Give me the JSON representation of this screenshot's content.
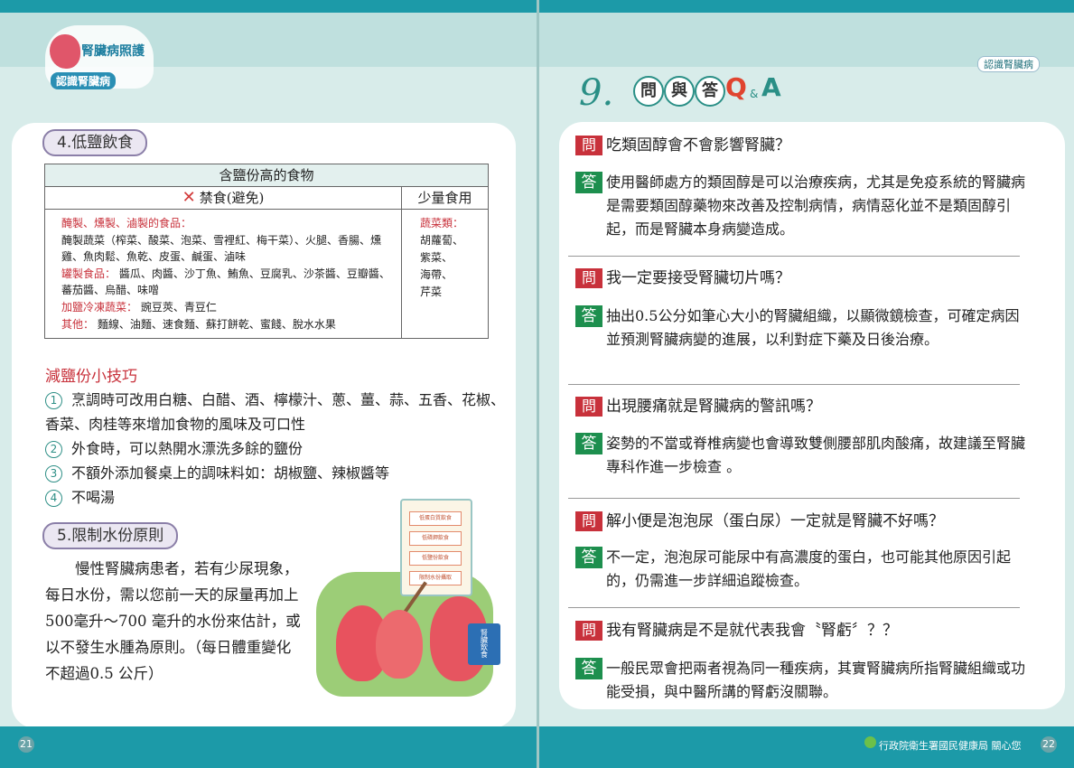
{
  "left_page": {
    "logo": {
      "title": "腎臟病照護",
      "subtitle": "認識腎臟病"
    },
    "section4": {
      "title": "4.低鹽飲食",
      "table": {
        "header": "含鹽份高的食物",
        "col_forbidden": "禁食(避免)",
        "col_small": "少量食用",
        "forbidden_items": [
          {
            "category": "醃製、燻製、滷製的食品：",
            "text": ""
          },
          {
            "category": "",
            "text": "醃製蔬菜（榨菜、酸菜、泡菜、雪裡紅、梅干菜）、火腿、香腸、燻雞、魚肉鬆、魚乾、皮蛋、鹹蛋、滷味"
          },
          {
            "category": "罐製食品：",
            "text": "醬瓜、肉醬、沙丁魚、鮪魚、豆腐乳、沙茶醬、豆瓣醬、蕃茄醬、烏醋、味噌"
          },
          {
            "category": "加鹽冷凍蔬菜：",
            "text": "豌豆莢、青豆仁"
          },
          {
            "category": "其他：",
            "text": "麵線、油麵、速食麵、蘇打餅乾、蜜餞、脫水水果"
          }
        ],
        "small_category": "蔬菜類：",
        "small_items": [
          "胡蘿蔔、",
          "紫菜、",
          "海帶、",
          "芹菜"
        ]
      },
      "tips_title": "減鹽份小技巧",
      "tips": [
        {
          "num": "1",
          "text": "烹調時可改用白糖、白醋、酒、檸檬汁、蔥、薑、蒜、五香、花椒、香菜、肉桂等來增加食物的風味及可口性"
        },
        {
          "num": "2",
          "text": "外食時，可以熱開水漂洗多餘的鹽份"
        },
        {
          "num": "3",
          "text": "不額外添加餐桌上的調味料如：胡椒鹽、辣椒醬等"
        },
        {
          "num": "4",
          "text": "不喝湯"
        }
      ]
    },
    "section5": {
      "title": "5.限制水份原則",
      "text": "慢性腎臟病患者，若有少尿現象，每日水份，需以您前一天的尿量再加上500毫升～700 毫升的水份來估計，或以不發生水腫為原則。（每日體重變化不超過0.5 公斤）"
    },
    "illustration": {
      "scroll_items": [
        "低蛋白質飲食",
        "低磷鉀飲食",
        "低鹽份飲食",
        "限制水份攝取"
      ],
      "book_label": "腎臟飲食"
    },
    "page_number": "21"
  },
  "right_page": {
    "top_tag": "認識腎臟病",
    "heading": {
      "number": "9.",
      "chars": [
        "問",
        "與",
        "答"
      ],
      "q": "Q",
      "amp": "&",
      "a": "A"
    },
    "q_label": "問",
    "a_label": "答",
    "qa": [
      {
        "q": "吃類固醇會不會影響腎臟？",
        "a": "使用醫師處方的類固醇是可以治療疾病，尤其是免疫系統的腎臟病是需要類固醇藥物來改善及控制病情，病情惡化並不是類固醇引起，而是腎臟本身病變造成。"
      },
      {
        "q": "我一定要接受腎臟切片嗎？",
        "a": "抽出0.5公分如筆心大小的腎臟組織，以顯微鏡檢查，可確定病因並預測腎臟病變的進展，以利對症下藥及日後治療。"
      },
      {
        "q": "出現腰痛就是腎臟病的警訊嗎？",
        "a": "姿勢的不當或脊椎病變也會導致雙側腰部肌肉酸痛，故建議至腎臟專科作進一步檢查 。"
      },
      {
        "q": "解小便是泡泡尿（蛋白尿）一定就是腎臟不好嗎？",
        "a": "不一定，泡泡尿可能尿中有高濃度的蛋白，也可能其他原因引起的，仍需進一步詳細追蹤檢查。"
      },
      {
        "q": "我有腎臟病是不是就代表我會〝腎虧〞？？",
        "a": "一般民眾會把兩者視為同一種疾病，其實腎臟病所指腎臟組織或功能受損，與中醫所講的腎虧沒關聯。"
      }
    ],
    "footer": "行政院衛生署國民健康局 關心您",
    "page_number": "22"
  }
}
